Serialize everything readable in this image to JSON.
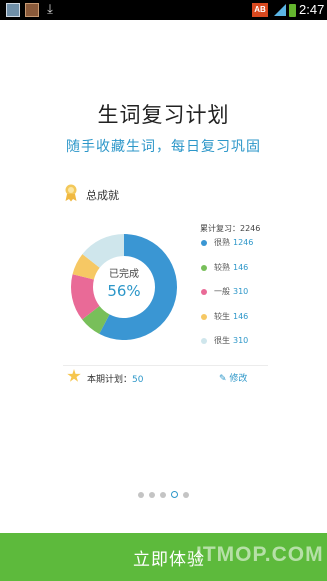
{
  "status_bar": {
    "time": "2:47",
    "badge": "AB",
    "icons": [
      "app-icon-1",
      "app-icon-2",
      "download-icon",
      "ab-badge-icon",
      "signal-icon",
      "battery-icon"
    ]
  },
  "title": "生词复习计划",
  "subtitle": "随手收藏生词，每日复习巩固",
  "achievement": {
    "title": "总成就",
    "total_label": "累计复习：",
    "total_value": "2246",
    "completed_label": "已完成",
    "completed_pct": "56%",
    "legend": [
      {
        "label": "很熟",
        "value": "1246",
        "color": "#3a96d3"
      },
      {
        "label": "较熟",
        "value": "146",
        "color": "#78bf5a"
      },
      {
        "label": "一般",
        "value": "310",
        "color": "#e96a97"
      },
      {
        "label": "较生",
        "value": "146",
        "color": "#f6c864"
      },
      {
        "label": "很生",
        "value": "310",
        "color": "#cfe6ec"
      }
    ]
  },
  "plan": {
    "label": "本期计划：",
    "value": "50",
    "edit_label": "修改"
  },
  "pager": {
    "count": 5,
    "active_index": 3
  },
  "cta": {
    "label": "立即体验"
  },
  "watermark": "ITMOP.COM"
}
